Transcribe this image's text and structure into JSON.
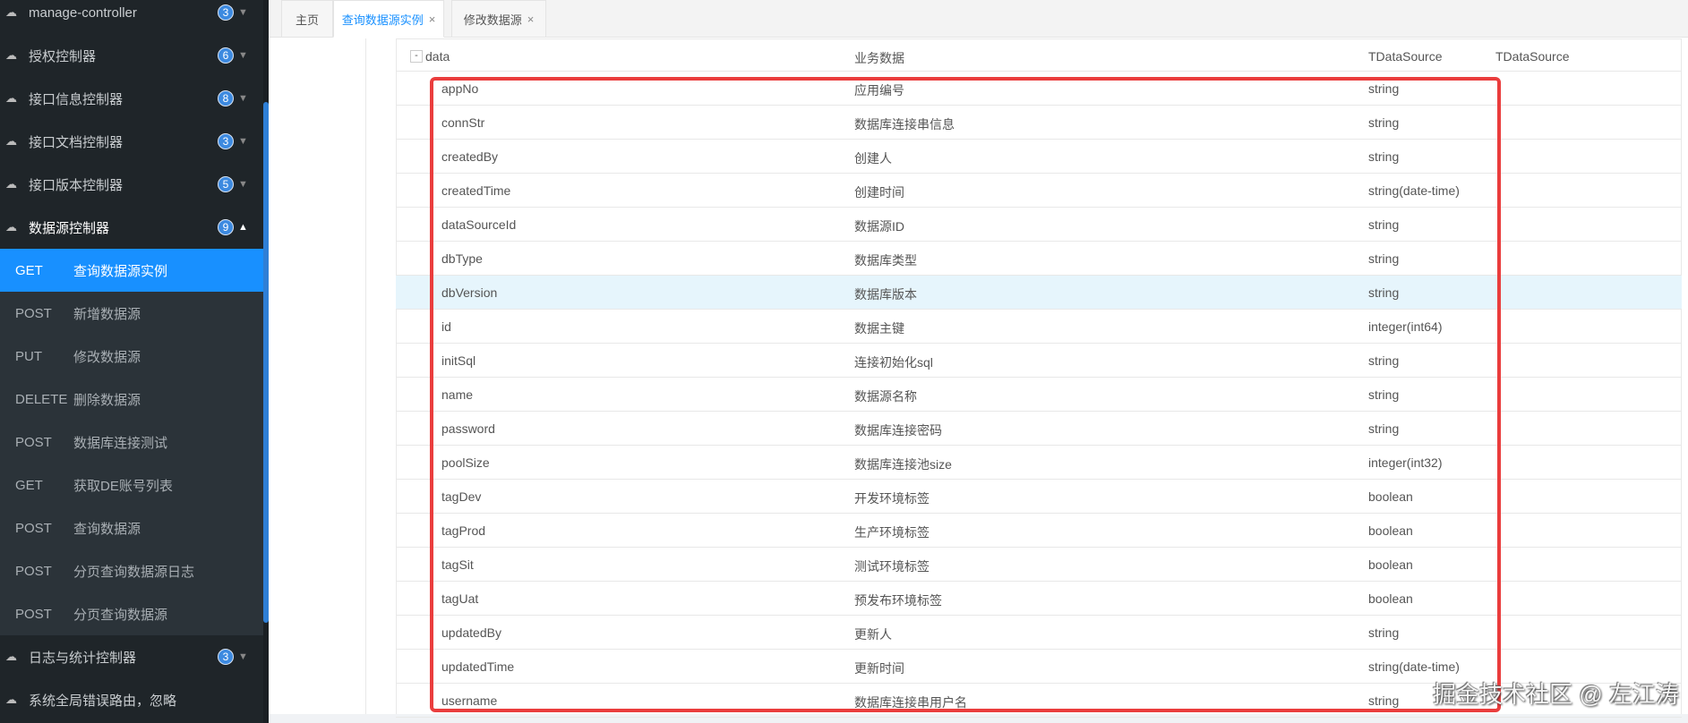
{
  "sidebar": {
    "groups_top": [
      {
        "label": "manage-controller",
        "count": "3"
      },
      {
        "label": "授权控制器",
        "count": "6"
      },
      {
        "label": "接口信息控制器",
        "count": "8"
      },
      {
        "label": "接口文档控制器",
        "count": "3"
      },
      {
        "label": "接口版本控制器",
        "count": "5"
      },
      {
        "label": "数据源控制器",
        "count": "9"
      }
    ],
    "items": [
      {
        "method": "GET",
        "label": "查询数据源实例"
      },
      {
        "method": "POST",
        "label": "新增数据源"
      },
      {
        "method": "PUT",
        "label": "修改数据源"
      },
      {
        "method": "DELETE",
        "label": "删除数据源"
      },
      {
        "method": "POST",
        "label": "数据库连接测试"
      },
      {
        "method": "GET",
        "label": "获取DE账号列表"
      },
      {
        "method": "POST",
        "label": "查询数据源"
      },
      {
        "method": "POST",
        "label": "分页查询数据源日志"
      },
      {
        "method": "POST",
        "label": "分页查询数据源"
      }
    ],
    "groups_bottom": [
      {
        "label": "日志与统计控制器",
        "count": "3"
      },
      {
        "label": "系统全局错误路由，忽略"
      }
    ]
  },
  "tabs": [
    {
      "label": "主页"
    },
    {
      "label": "查询数据源实例",
      "close": "×"
    },
    {
      "label": "修改数据源",
      "close": "×"
    }
  ],
  "table": {
    "header": {
      "toggle": "-",
      "name": "data",
      "desc": "业务数据",
      "type": "TDataSource",
      "schema": "TDataSource"
    },
    "rows": [
      {
        "name": "appNo",
        "desc": "应用编号",
        "type": "string"
      },
      {
        "name": "connStr",
        "desc": "数据库连接串信息",
        "type": "string"
      },
      {
        "name": "createdBy",
        "desc": "创建人",
        "type": "string"
      },
      {
        "name": "createdTime",
        "desc": "创建时间",
        "type": "string(date-time)"
      },
      {
        "name": "dataSourceId",
        "desc": "数据源ID",
        "type": "string"
      },
      {
        "name": "dbType",
        "desc": "数据库类型",
        "type": "string"
      },
      {
        "name": "dbVersion",
        "desc": "数据库版本",
        "type": "string"
      },
      {
        "name": "id",
        "desc": "数据主键",
        "type": "integer(int64)"
      },
      {
        "name": "initSql",
        "desc": "连接初始化sql",
        "type": "string"
      },
      {
        "name": "name",
        "desc": "数据源名称",
        "type": "string"
      },
      {
        "name": "password",
        "desc": "数据库连接密码",
        "type": "string"
      },
      {
        "name": "poolSize",
        "desc": "数据库连接池size",
        "type": "integer(int32)"
      },
      {
        "name": "tagDev",
        "desc": "开发环境标签",
        "type": "boolean"
      },
      {
        "name": "tagProd",
        "desc": "生产环境标签",
        "type": "boolean"
      },
      {
        "name": "tagSit",
        "desc": "测试环境标签",
        "type": "boolean"
      },
      {
        "name": "tagUat",
        "desc": "预发布环境标签",
        "type": "boolean"
      },
      {
        "name": "updatedBy",
        "desc": "更新人",
        "type": "string"
      },
      {
        "name": "updatedTime",
        "desc": "更新时间",
        "type": "string(date-time)"
      },
      {
        "name": "username",
        "desc": "数据库连接串用户名",
        "type": "string"
      }
    ]
  },
  "watermark": "掘金技术社区 @ 左江涛",
  "colors": {
    "accent": "#1890ff",
    "highlight": "#ea3d3d",
    "sidebar": "#1f2529"
  }
}
